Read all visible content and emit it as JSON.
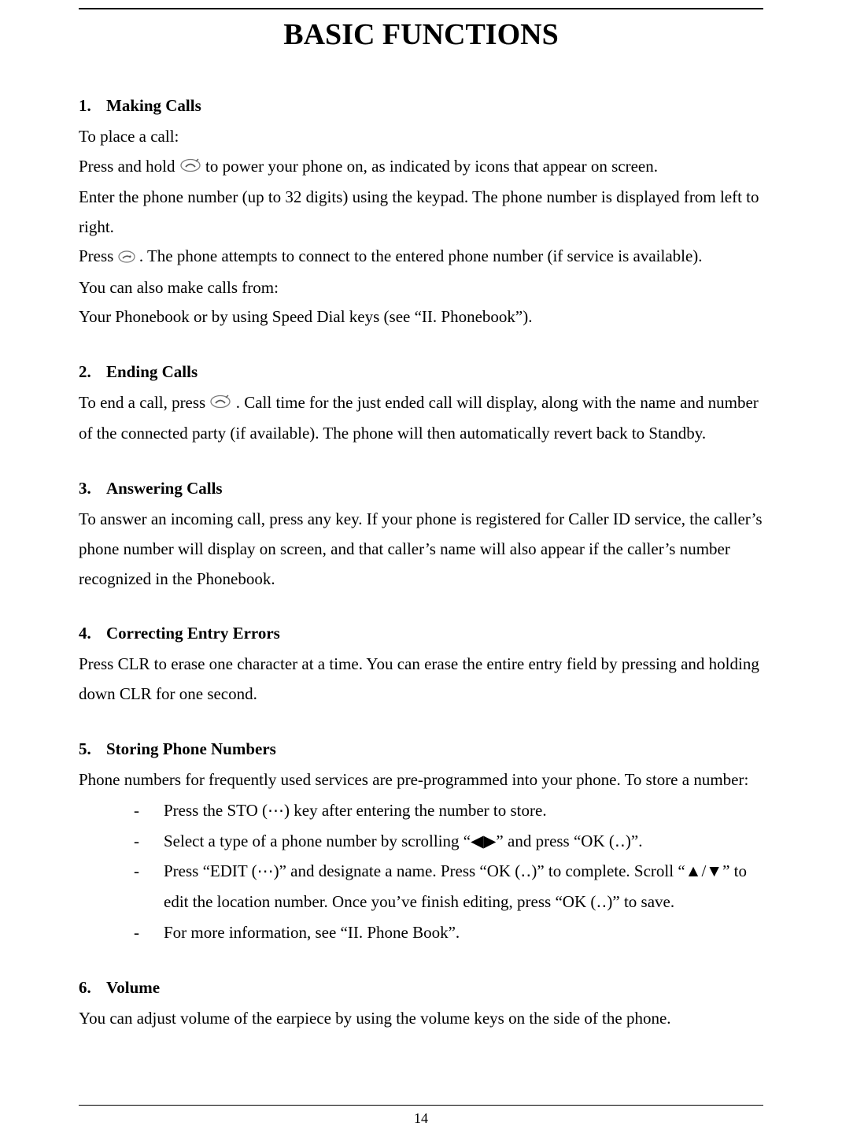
{
  "title": "BASIC FUNCTIONS",
  "sections": {
    "s1": {
      "num": "1.",
      "label": "Making Calls"
    },
    "s2": {
      "num": "2.",
      "label": "Ending Calls"
    },
    "s3": {
      "num": "3.",
      "label": "Answering Calls"
    },
    "s4": {
      "num": "4.",
      "label": "Correcting Entry Errors"
    },
    "s5": {
      "num": "5.",
      "label": "Storing Phone Numbers"
    },
    "s6": {
      "num": "6.",
      "label": "Volume"
    }
  },
  "body": {
    "s1_a": "To place a call:",
    "s1_b_pre": "Press and hold  ",
    "s1_b_post": "  to power your phone on, as indicated by icons that appear on screen.",
    "s1_c": "Enter the phone number (up to 32 digits) using the keypad. The phone number is displayed from left to right.",
    "s1_d_pre": "Press  ",
    "s1_d_post": ". The phone attempts to connect to the entered phone number (if service is available).",
    "s1_e": "You can also make calls from:",
    "s1_f": "Your Phonebook or by using Speed Dial keys (see “II. Phonebook”).",
    "s2_a_pre": "To end a call, press  ",
    "s2_a_post": " . Call time for the just ended call will display, along with the name and number of the connected party (if available).    The phone will then automatically revert back to Standby.",
    "s3_a": "To answer an incoming call, press any key. If your phone is registered for Caller ID service, the caller’s phone number will display on screen, and that caller’s name will also appear if the caller’s number recognized in the Phonebook.",
    "s4_a": "Press CLR to erase one character at a time. You can erase the entire entry field by pressing and holding down CLR for one second.",
    "s5_a": "Phone numbers for frequently used services are pre-programmed into your phone. To store a number:",
    "s5_list": {
      "i1": "Press the STO (⋯) key after entering the number to store.",
      "i2": "Select a type of a phone number by scrolling “◀▶” and press “OK (‥)”.",
      "i3": "Press “EDIT (⋯)” and designate a name. Press “OK (‥)” to complete. Scroll “▲/▼” to edit the location number. Once you’ve finish editing, press “OK (‥)” to save.",
      "i4": "For more information, see “II. Phone Book”."
    },
    "s6_a": "You can adjust volume of the earpiece by using the volume keys on the side of the phone."
  },
  "dash": "-",
  "page_number": "14"
}
